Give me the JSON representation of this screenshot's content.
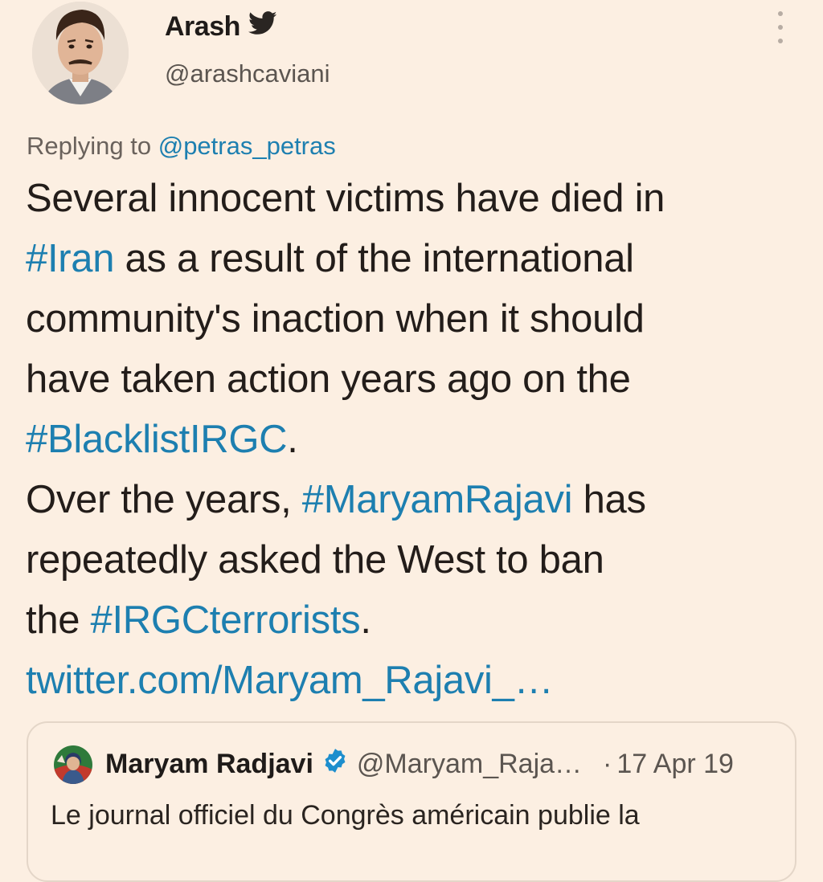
{
  "author": {
    "display_name": "Arash",
    "handle": "@arashcaviani",
    "badge_icon": "twitter-bird-icon"
  },
  "reply": {
    "prefix": "Replying to",
    "to_handle": "@petras_petras"
  },
  "tweet": {
    "segments": [
      {
        "text": "Several innocent victims have died in",
        "link": false
      },
      {
        "text": "#Iran",
        "link": true
      },
      {
        "text": " as a result of the international",
        "link": false
      },
      {
        "text": "community's inaction when it should",
        "link": false
      },
      {
        "text": "have taken action years ago on the",
        "link": false
      },
      {
        "text": "#BlacklistIRGC",
        "link": true
      },
      {
        "text": ".",
        "link": false
      },
      {
        "text": "Over the years, ",
        "link": false
      },
      {
        "text": "#MaryamRajavi",
        "link": true
      },
      {
        "text": " has",
        "link": false
      },
      {
        "text": "repeatedly asked the West to ban",
        "link": false
      },
      {
        "text": "the ",
        "link": false
      },
      {
        "text": "#IRGCterrorists",
        "link": true
      },
      {
        "text": ".",
        "link": false
      },
      {
        "text": "twitter.com/Maryam_Rajavi_…",
        "link": true
      }
    ]
  },
  "quote": {
    "name": "Maryam Radjavi",
    "verified_icon": "verified-badge-icon",
    "handle": "@Maryam_Raja…",
    "separator": "·",
    "date": "17 Apr 19",
    "text": "Le journal officiel du Congrès américain publie la"
  },
  "colors": {
    "background": "#fcefe2",
    "link": "#1d7fb0",
    "text": "#231d1a",
    "muted": "#5b5550",
    "border": "#e4d6c8"
  }
}
